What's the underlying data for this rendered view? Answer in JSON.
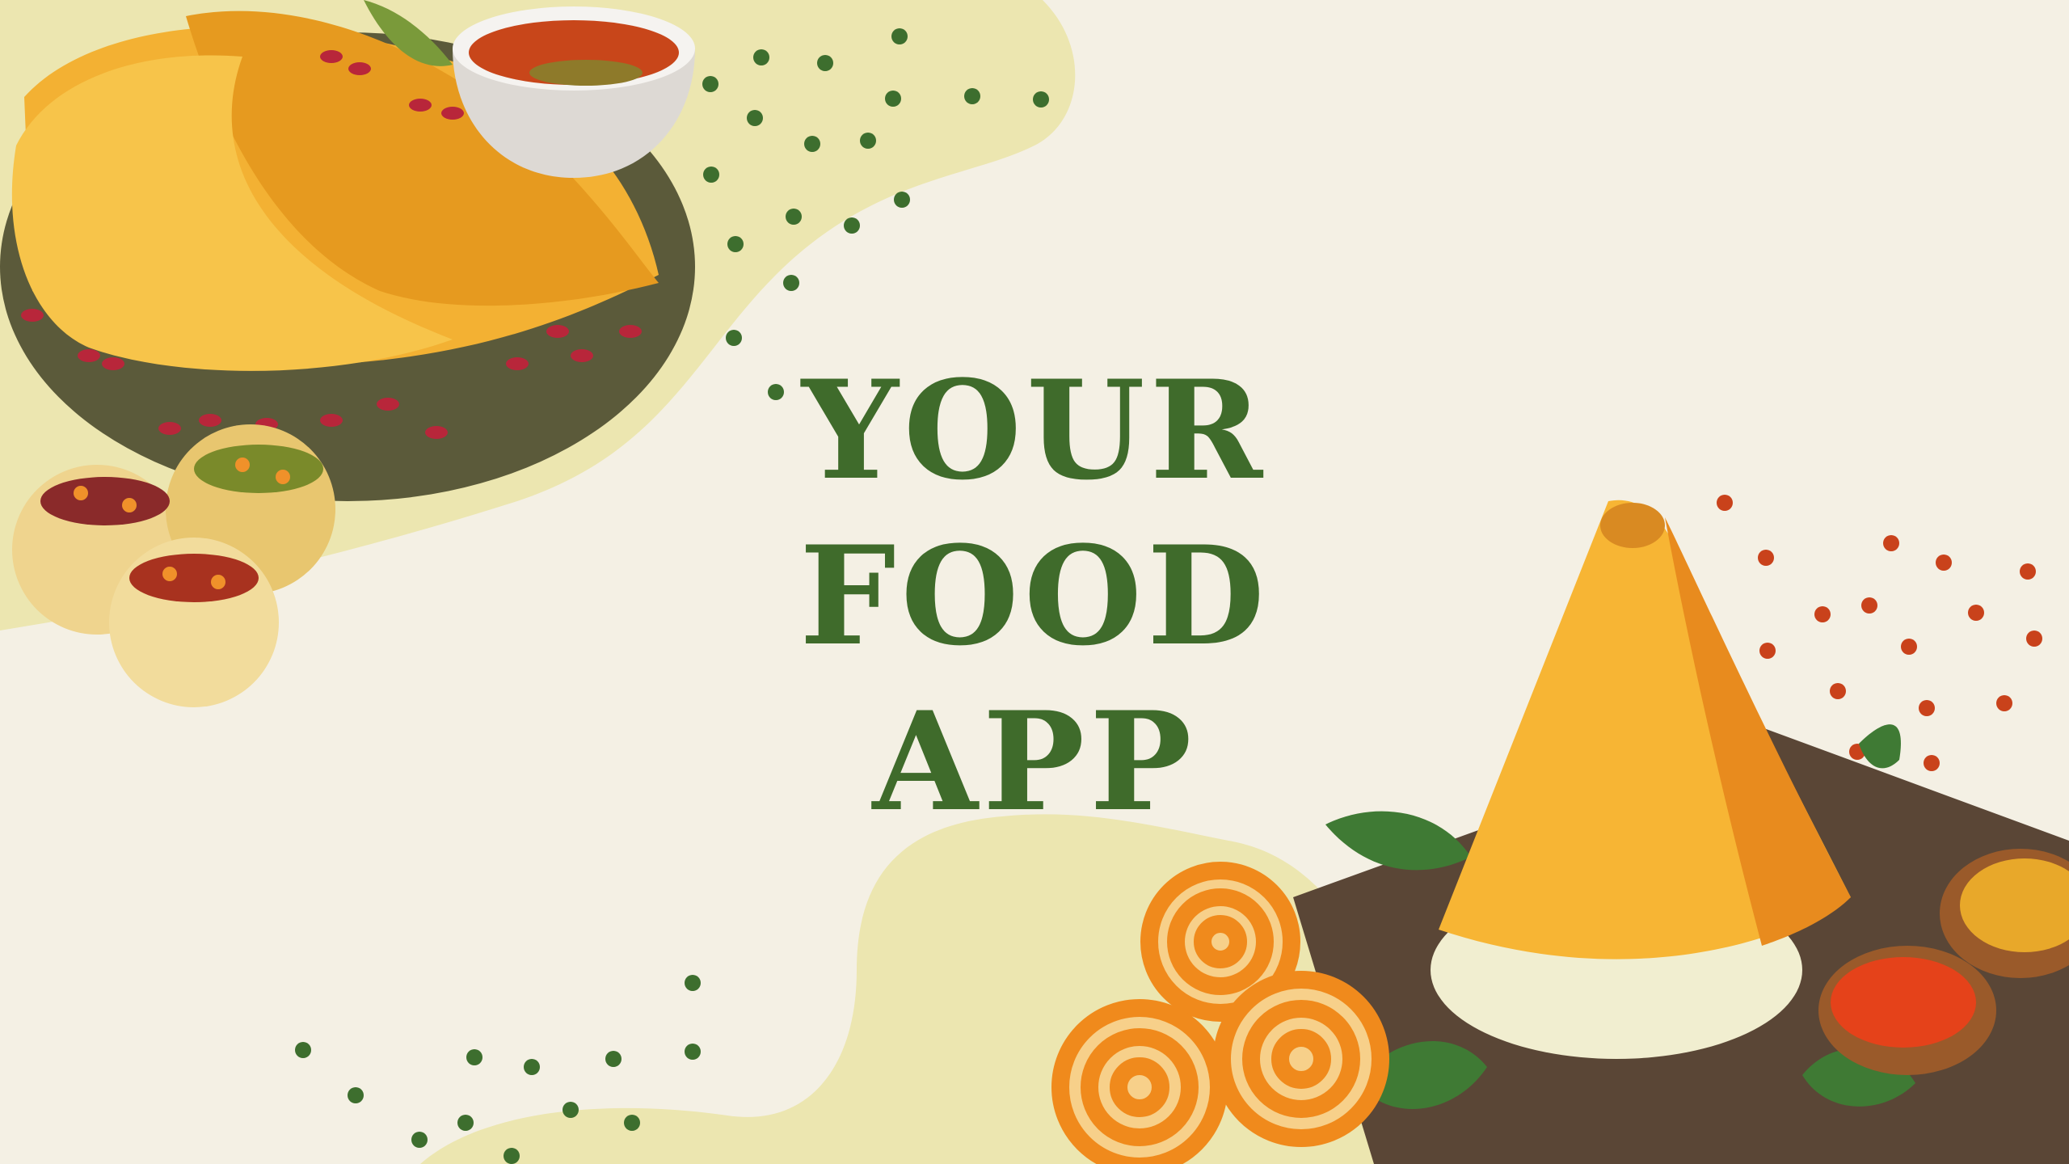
{
  "title": {
    "line1": "YOUR",
    "line2": "FOOD",
    "line3": "APP"
  },
  "colors": {
    "background": "#f4f0e4",
    "blob": "#ece6b0",
    "title": "#3f6b2b",
    "green_dots": "#3d6e2e",
    "orange_dots": "#c9421b",
    "plate": "#5b5a3a",
    "dosa": "#f3b133",
    "tray": "#5a4636"
  },
  "illustrations": [
    "dosa-plate-illustration",
    "chutney-bowl-illustration",
    "pani-puri-illustration",
    "masala-dosa-cone-illustration",
    "jalebi-illustration",
    "spice-bowl-illustration"
  ]
}
